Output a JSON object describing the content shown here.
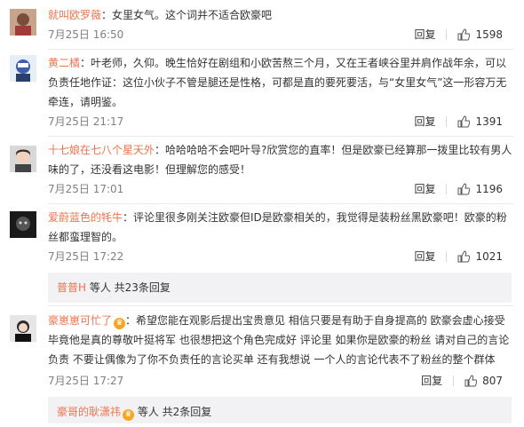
{
  "comments": [
    {
      "user": "就叫欧罗薇",
      "text": "：女里女气。这个词并不适合欧豪吧",
      "time": "7月25日 16:50",
      "reply": "回复",
      "likes": "1598"
    },
    {
      "user": "黄二橘",
      "text": "：叶老师，久仰。晚生恰好在剧组和小欧苦熬三个月，又在王者峡谷里并肩作战年余，可以负责任地作证：这位小伙子不管是腿还是性格，可都是直的要死要活，与“女里女气”这一形容万无牵连，请明鉴。",
      "time": "7月25日 21:17",
      "reply": "回复",
      "likes": "1391"
    },
    {
      "user": "十七娘在七八个星天外",
      "text": "：哈哈哈哈不会吧叶导?欣赏您的直率！但是欧豪已经算那一拨里比较有男人味的了，还没看这电影！但理解您的感受！",
      "time": "7月25日 17:01",
      "reply": "回复",
      "likes": "1196"
    },
    {
      "user": "爱蔚蓝色的牦牛",
      "text": "：评论里很多刚关注欧豪但ID是欧豪相关的，我觉得是装粉丝黑欧豪吧！欧豪的粉丝都蛮理智的。",
      "time": "7月25日 17:22",
      "reply": "回复",
      "likes": "1021",
      "sub_user": "普普H",
      "sub_text": " 等人 共23条回复"
    },
    {
      "user": "豪崽崽可忙了",
      "text": "：希望您能在观影后提出宝贵意见 相信只要是有助于自身提高的 欧豪会虚心接受 毕竟他是真的尊敬叶挺将军 也很想把这个角色完成好 评论里 如果你是欧豪的粉丝 请对自己的言论负责 不要让偶像为了你不负责任的言论买单 还有我想说 一个人的言论代表不了粉丝的整个群体",
      "time": "7月25日 17:27",
      "reply": "回复",
      "likes": "807",
      "sub_user": "豪哥的耿潇祎",
      "sub_text": " 等人 共2条回复"
    }
  ],
  "colors": {
    "username": "#eb7350",
    "time": "#808080",
    "sub_bg": "#f2f2f5",
    "badge": "#f5a623"
  },
  "icons": {
    "like": "thumb-up-icon",
    "badge": "vip-crown-icon"
  }
}
